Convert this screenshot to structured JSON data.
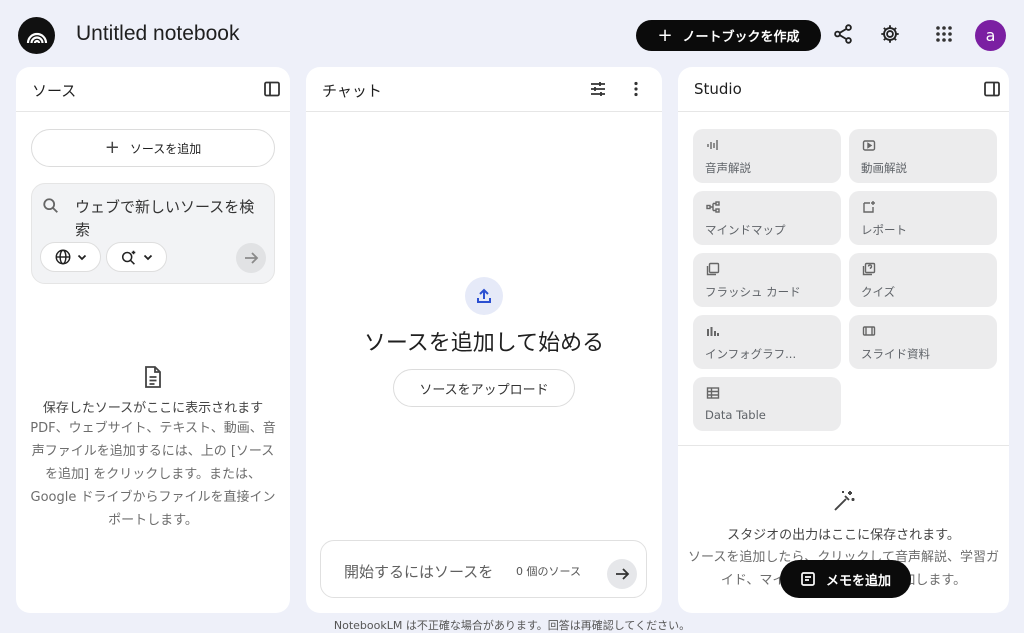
{
  "header": {
    "title": "Untitled notebook",
    "create_label": "ノートブックを作成",
    "avatar_letter": "a"
  },
  "sources": {
    "title": "ソース",
    "add_label": "ソースを追加",
    "search_placeholder": "ウェブで新しいソースを検索",
    "empty_heading": "保存したソースがここに表示されます",
    "empty_body": "PDF、ウェブサイト、テキスト、動画、音声ファイルを追加するには、上の [ソースを追加] をクリックします。または、Google ドライブからファイルを直接インポートします。"
  },
  "chat": {
    "title": "チャット",
    "heading": "ソースを追加して始める",
    "upload_label": "ソースをアップロード",
    "input_placeholder": "開始するにはソースを",
    "source_count": "0 個のソース"
  },
  "studio": {
    "title": "Studio",
    "tiles": [
      {
        "label": "音声解説",
        "icon": "audio-wave-icon"
      },
      {
        "label": "動画解説",
        "icon": "video-icon"
      },
      {
        "label": "マインドマップ",
        "icon": "mind-map-icon"
      },
      {
        "label": "レポート",
        "icon": "report-icon"
      },
      {
        "label": "フラッシュ カード",
        "icon": "flashcard-icon"
      },
      {
        "label": "クイズ",
        "icon": "quiz-icon"
      },
      {
        "label": "インフォグラフ...",
        "icon": "infographic-icon"
      },
      {
        "label": "スライド資料",
        "icon": "slides-icon"
      },
      {
        "label": "Data Table",
        "icon": "table-icon"
      }
    ],
    "empty_heading": "スタジオの出力はここに保存されます。",
    "empty_body": "ソースを追加したら、クリックして音声解説、学習ガイド、マインドマップなどを追加します。",
    "memo_label": "メモを追加"
  },
  "footer": "NotebookLM は不正確な場合があります。回答は再確認してください。"
}
